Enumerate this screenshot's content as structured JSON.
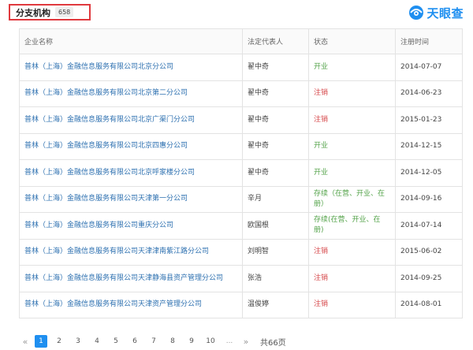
{
  "header": {
    "title": "分支机构",
    "count": "658",
    "logo_text": "天眼查"
  },
  "table": {
    "columns": [
      "企业名称",
      "法定代表人",
      "状态",
      "注册时间"
    ],
    "rows": [
      {
        "company": "普林（上海）金融信息服务有限公司北京分公司",
        "rep": "翟中奇",
        "status": "开业",
        "status_type": "green",
        "date": "2014-07-07"
      },
      {
        "company": "普林（上海）金融信息服务有限公司北京第二分公司",
        "rep": "翟中奇",
        "status": "注销",
        "status_type": "red",
        "date": "2014-06-23"
      },
      {
        "company": "普林（上海）金融信息服务有限公司北京广渠门分公司",
        "rep": "翟中奇",
        "status": "注销",
        "status_type": "red",
        "date": "2015-01-23"
      },
      {
        "company": "普林（上海）金融信息服务有限公司北京四惠分公司",
        "rep": "翟中奇",
        "status": "开业",
        "status_type": "green",
        "date": "2014-12-15"
      },
      {
        "company": "普林（上海）金融信息服务有限公司北京呼家楼分公司",
        "rep": "翟中奇",
        "status": "开业",
        "status_type": "green",
        "date": "2014-12-05"
      },
      {
        "company": "普林（上海）金融信息服务有限公司天津第一分公司",
        "rep": "辛月",
        "status": "存续（在营、开业、在册）",
        "status_type": "green",
        "date": "2014-09-16"
      },
      {
        "company": "普林（上海）金融信息服务有限公司重庆分公司",
        "rep": "欧国根",
        "status": "存续(在营、开业、在册)",
        "status_type": "green",
        "date": "2014-07-14"
      },
      {
        "company": "普林（上海）金融信息服务有限公司天津津南紫江路分公司",
        "rep": "刘明智",
        "status": "注销",
        "status_type": "red",
        "date": "2015-06-02"
      },
      {
        "company": "普林（上海）金融信息服务有限公司天津静海县资产管理分公司",
        "rep": "张浩",
        "status": "注销",
        "status_type": "red",
        "date": "2014-09-25"
      },
      {
        "company": "普林（上海）金融信息服务有限公司天津资产管理分公司",
        "rep": "温俊婷",
        "status": "注销",
        "status_type": "red",
        "date": "2014-08-01"
      }
    ]
  },
  "pagination": {
    "prev": "«",
    "pages": [
      "1",
      "2",
      "3",
      "4",
      "5",
      "6",
      "7",
      "8",
      "9",
      "10"
    ],
    "active": "1",
    "ellipsis": "...",
    "next": "»",
    "total": "共66页"
  },
  "colors": {
    "highlight_border": "#e0393e",
    "link": "#2d70b0",
    "status_green": "#54a34a",
    "status_red": "#d6474a",
    "brand": "#1f8ff0"
  }
}
